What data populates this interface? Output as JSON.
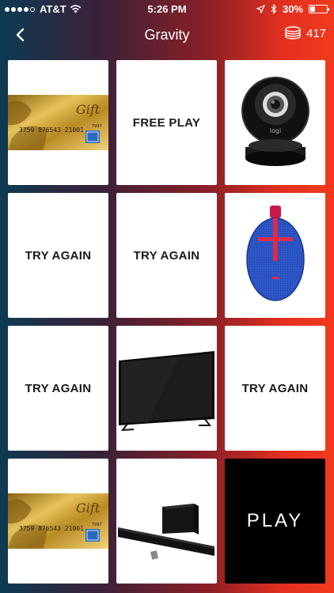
{
  "status_bar": {
    "carrier": "AT&T",
    "time": "5:26 PM",
    "battery": "30%",
    "battery_level": 0.3
  },
  "nav": {
    "title": "Gravity",
    "coins": "417"
  },
  "tiles": [
    {
      "kind": "gift-card",
      "card_number": "3759 876543 21001",
      "card_code": "7997"
    },
    {
      "kind": "text",
      "label": "FREE PLAY"
    },
    {
      "kind": "camera",
      "brand": "logi"
    },
    {
      "kind": "text",
      "label": "TRY AGAIN"
    },
    {
      "kind": "text",
      "label": "TRY AGAIN"
    },
    {
      "kind": "speaker"
    },
    {
      "kind": "text",
      "label": "TRY AGAIN"
    },
    {
      "kind": "tv"
    },
    {
      "kind": "text",
      "label": "TRY AGAIN"
    },
    {
      "kind": "gift-card",
      "card_number": "3759 876543 21001",
      "card_code": "7997"
    },
    {
      "kind": "soundbar"
    },
    {
      "kind": "play",
      "label": "PLAY"
    }
  ]
}
